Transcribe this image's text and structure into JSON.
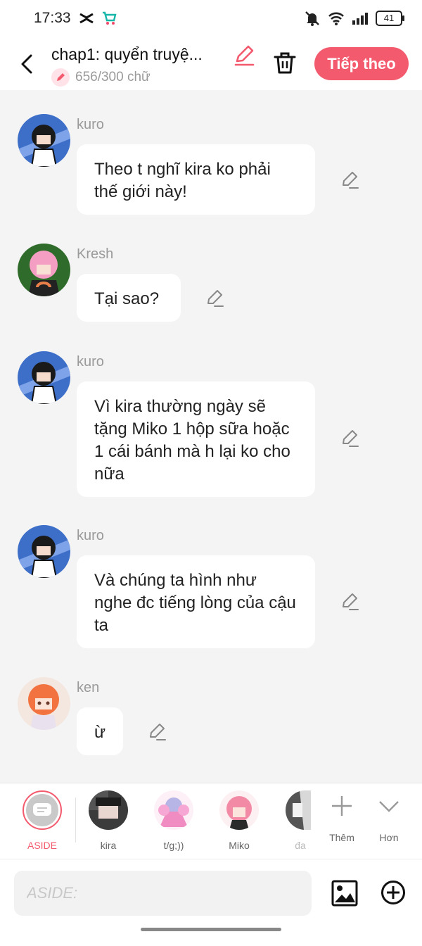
{
  "status_bar": {
    "time": "17:33",
    "battery": "41"
  },
  "header": {
    "back_icon": "chevron-left-icon",
    "title": "chap1: quyển truyệ...",
    "word_count": "656/300 chữ",
    "next_label": "Tiếp theo"
  },
  "messages": [
    {
      "sender": "kuro",
      "text": "Theo t nghĩ kira ko phải thế giới này!"
    },
    {
      "sender": "Kresh",
      "text": "Tại sao?"
    },
    {
      "sender": "kuro",
      "text": "Vì kira thường ngày sẽ tặng Miko 1 hộp sữa hoặc 1 cái bánh mà h lại ko cho nữa"
    },
    {
      "sender": "kuro",
      "text": "Và chúng ta hình như nghe đc tiếng  lòng của cậu ta"
    },
    {
      "sender": "ken",
      "text": "ừ"
    }
  ],
  "characters": [
    {
      "label": "ASIDE"
    },
    {
      "label": "kira"
    },
    {
      "label": "t/g;))"
    },
    {
      "label": "Miko"
    },
    {
      "label": "đa"
    }
  ],
  "actions": {
    "add_label": "Thêm",
    "more_label": "Hơn"
  },
  "input": {
    "placeholder": "ASIDE:"
  },
  "colors": {
    "accent": "#f45a6e",
    "background": "#f4f4f4"
  }
}
